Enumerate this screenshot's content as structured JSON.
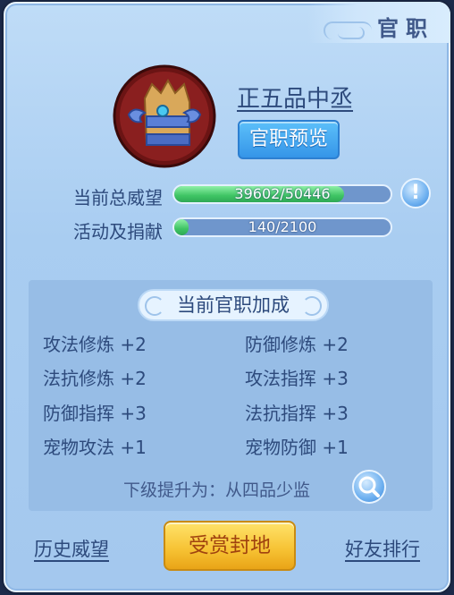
{
  "title": "官职",
  "rank": {
    "name": "正五品中丞",
    "preview_label": "官职预览"
  },
  "stats": {
    "prestige_label": "当前总威望",
    "prestige_value": "39602/50446",
    "prestige_fraction": 0.785,
    "activity_label": "活动及捐献",
    "activity_value": "140/2100",
    "activity_fraction": 0.067,
    "info_glyph": "!"
  },
  "bonus": {
    "title": "当前官职加成",
    "items": [
      "攻法修炼 +2",
      "防御修炼 +2",
      "法抗修炼 +2",
      "攻法指挥 +3",
      "防御指挥 +3",
      "法抗指挥 +3",
      "宠物攻法 +1",
      "宠物防御 +1"
    ],
    "next_text": "下级提升为：从四品少监"
  },
  "footer": {
    "history_label": "历史威望",
    "reward_label": "受赏封地",
    "ranking_label": "好友排行"
  },
  "colors": {
    "accent": "#2d4a7c",
    "progress_green": "#3ec463",
    "gold": "#f6c132"
  }
}
